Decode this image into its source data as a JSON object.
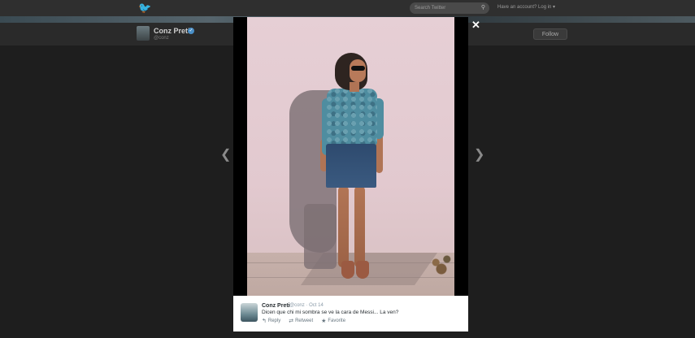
{
  "topbar": {
    "search_placeholder": "Search Twitter",
    "login_text": "Have an account? Log in"
  },
  "profile": {
    "name": "Conz Preti",
    "handle": "@conz",
    "follow_label": "Follow"
  },
  "tweet": {
    "name": "Conz Preti",
    "handle": "@conz",
    "date": "Oct 14",
    "text": "Dicen que chi mi sombra se ve la cara de Messi... La ven?",
    "actions": [
      {
        "label": "Reply",
        "icon": "reply-icon"
      },
      {
        "label": "Retweet",
        "icon": "retweet-icon"
      },
      {
        "label": "Favorite",
        "icon": "star-icon"
      }
    ]
  },
  "colors": {
    "overlay": "#1e1e1e",
    "twitter_blue": "#5ea9dd",
    "wall": "#e6cfd5"
  }
}
